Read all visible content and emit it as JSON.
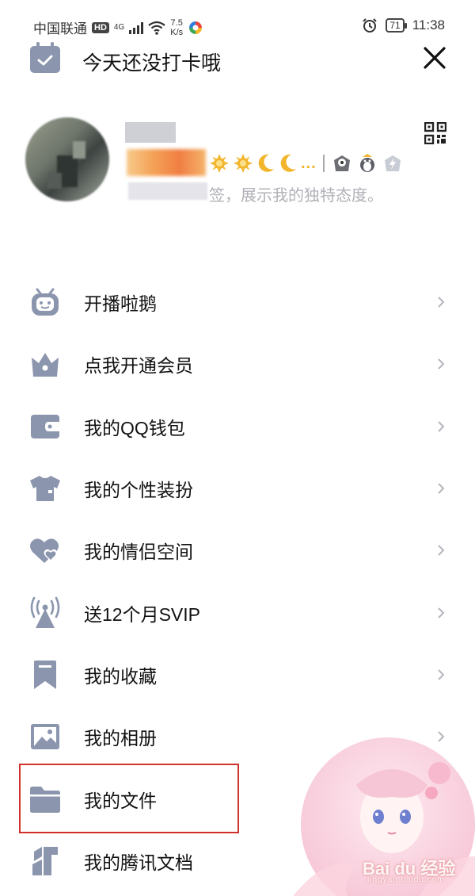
{
  "status_bar": {
    "carrier": "中国联通",
    "hd": "HD",
    "network": "4G",
    "speed_value": "7.5",
    "speed_unit": "K/s",
    "battery": "71",
    "time": "11:38"
  },
  "header": {
    "title": "今天还没打卡哦"
  },
  "profile": {
    "signature_suffix": "签，展示我的独特态度。",
    "badge_more": "..."
  },
  "menu": {
    "items": [
      {
        "label": "开播啦鹅",
        "icon": "tv-mascot-icon"
      },
      {
        "label": "点我开通会员",
        "icon": "crown-icon"
      },
      {
        "label": "我的QQ钱包",
        "icon": "wallet-icon"
      },
      {
        "label": "我的个性装扮",
        "icon": "tshirt-icon"
      },
      {
        "label": "我的情侣空间",
        "icon": "hearts-icon"
      },
      {
        "label": "送12个月SVIP",
        "icon": "broadcast-tower-icon"
      },
      {
        "label": "我的收藏",
        "icon": "bookmark-icon"
      },
      {
        "label": "我的相册",
        "icon": "photo-icon"
      },
      {
        "label": "我的文件",
        "icon": "folder-icon"
      },
      {
        "label": "我的腾讯文档",
        "icon": "docs-icon"
      }
    ]
  },
  "watermark": {
    "text": "Bai du 经验",
    "sub": "jingyan.baidu.com"
  },
  "colors": {
    "icon": "#8b95ad",
    "highlight": "#d0322b",
    "arrow": "#b5b5bd"
  }
}
